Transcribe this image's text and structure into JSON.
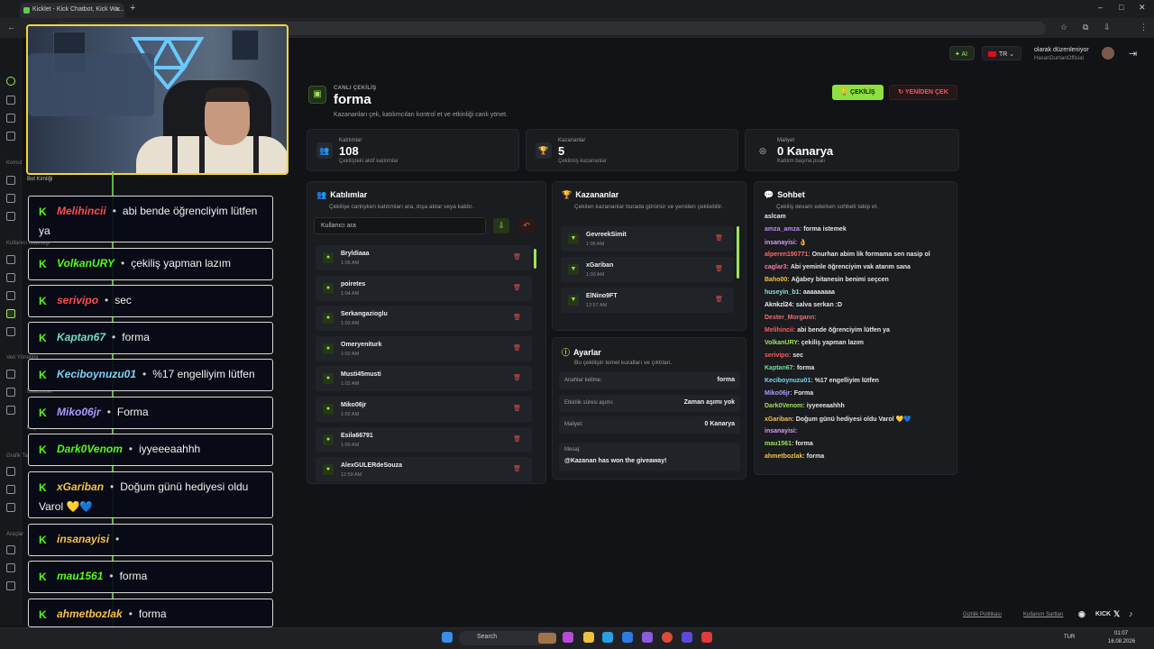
{
  "browser": {
    "tab_title": "Kicklet - Kick Chatbot, Kick Wa...",
    "new_tab": "+",
    "controls": [
      "–",
      "□",
      "✕"
    ]
  },
  "header": {
    "ai_label": "AI",
    "lang_label": "TR",
    "user_status": "olarak düzenleniyor",
    "user_name": "HasanDumanOfficial"
  },
  "rail": {
    "labels": [
      "Komut",
      "Bot Kimliği",
      "Kullanıcı İstatistiği",
      "Veri Yönetimi",
      "İstatistikler",
      "Kuyruklar",
      "Grafik Tasarımı",
      "Araçlar"
    ]
  },
  "page": {
    "kicker": "CANLI ÇEKİLİŞ",
    "title": "forma",
    "subtitle": "Kazananları çek, katılımcıları kontrol et ve etkinliği canlı yönet.",
    "draw_button": "ÇEKİLİŞ",
    "redraw_button": "YENİDEN ÇEK"
  },
  "stats": [
    {
      "label": "Katılımlar",
      "value": "108",
      "sub": "Çekilişteki aktif katılımlar"
    },
    {
      "label": "Kazananlar",
      "value": "5",
      "sub": "Çekilmiş kazananlar"
    },
    {
      "label": "Maliyet",
      "value": "0 Kanarya",
      "sub": "Katılım başına puan"
    }
  ],
  "participants": {
    "title": "Katılımlar",
    "subtitle": "Çekilişe canlıyken katılımları ara, dışa aktar veya kaldır.",
    "search_placeholder": "Kullanıcı ara",
    "rows": [
      {
        "name": "Bryldiaaa",
        "time": "1:05 AM"
      },
      {
        "name": "poiretes",
        "time": "1:04 AM"
      },
      {
        "name": "Serkangazioglu",
        "time": "1:03 AM"
      },
      {
        "name": "Omeryeniturk",
        "time": "1:02 AM"
      },
      {
        "name": "Musti45musti",
        "time": "1:02 AM"
      },
      {
        "name": "Miko06jr",
        "time": "1:02 AM"
      },
      {
        "name": "Esila66791",
        "time": "1:00 AM"
      },
      {
        "name": "AlexGULERdeSouza",
        "time": "12:59 AM"
      }
    ]
  },
  "winners": {
    "title": "Kazananlar",
    "subtitle": "Çekilen kazananlar burada görünür ve yeniden çekilebilir.",
    "rows": [
      {
        "name": "GevreekSimit",
        "time": "1:06 AM"
      },
      {
        "name": "xGariban",
        "time": "1:00 AM"
      },
      {
        "name": "ElNino9FT",
        "time": "12:57 AM"
      }
    ]
  },
  "settings": {
    "title": "Ayarlar",
    "subtitle": "Bu çekilişin temel kuralları ve çıktıları.",
    "rows": [
      {
        "key": "Anahtar kelime:",
        "value": "forma"
      },
      {
        "key": "Etkinlik süresi aşımı:",
        "value": "Zaman aşımı yok"
      },
      {
        "key": "Maliyet:",
        "value": "0 Kanarya"
      }
    ],
    "message_key": "Mesaj:",
    "message_value": "@Kazanan has won the giveaway!"
  },
  "chat": {
    "title": "Sohbet",
    "subtitle": "Çekiliş devam ederken sohbeti takip et.",
    "lines": [
      {
        "user": "aslcam",
        "text": "",
        "color": "#e8e8e8"
      },
      {
        "user": "amza_amza:",
        "text": "forma istemek",
        "color": "#c08cf0"
      },
      {
        "user": "insanayisi:",
        "text": "👌",
        "color": "#d69cf5"
      },
      {
        "user": "alperen190771:",
        "text": "Onurhan abim lik formama sen nasip ol",
        "color": "#ff6b6b"
      },
      {
        "user": "caglar3:",
        "text": "Abi yeminle öğrenciyim vak atarım sana",
        "color": "#ff7aa8"
      },
      {
        "user": "Baho00:",
        "text": "Ağabey bitanesin benimi seçcen",
        "color": "#f7c04a"
      },
      {
        "user": "huseyin_b1:",
        "text": "aaaaaaaaa",
        "color": "#8fe0d8"
      },
      {
        "user": "Aknkzl24:",
        "text": "salva serkan :D",
        "color": "#f4f4f4"
      },
      {
        "user": "Dexter_Morgann:",
        "text": "",
        "color": "#e87070"
      },
      {
        "user": "Melihincii:",
        "text": "abi bende öğrenciyim lütfen ya",
        "color": "#ff5b5b"
      },
      {
        "user": "VolkanURY:",
        "text": "çekiliş yapman lazım",
        "color": "#9ee35a"
      },
      {
        "user": "serivipo:",
        "text": "sec",
        "color": "#ff5b5b"
      },
      {
        "user": "Kaptan67:",
        "text": "forma",
        "color": "#6fe0a0"
      },
      {
        "user": "Keciboynuzu01:",
        "text": "%17 engelliyim lütfen",
        "color": "#7dd3f5"
      },
      {
        "user": "Miko06jr:",
        "text": "Forma",
        "color": "#a89cff"
      },
      {
        "user": "Dark0Venom:",
        "text": "iyyeeeaahhh",
        "color": "#9ee35a"
      },
      {
        "user": "xGariban:",
        "text": "Doğum günü hediyesi oldu Varol 💛💙",
        "color": "#f7c04a"
      },
      {
        "user": "insanayisi:",
        "text": "",
        "color": "#d69cf5"
      },
      {
        "user": "mau1561:",
        "text": "forma",
        "color": "#9ee35a"
      },
      {
        "user": "ahmetbozlak:",
        "text": "forma",
        "color": "#f7c04a"
      }
    ]
  },
  "overlay": {
    "k": "K",
    "dot": "•",
    "messages": [
      {
        "user": "Melihincii",
        "text": "abi bende öğrencliyim lütfen",
        "text2": "ya",
        "color": "#ff4d4d"
      },
      {
        "user": "VolkanURY",
        "text": "çekiliş yapman lazım",
        "color": "#53fc18"
      },
      {
        "user": "serivipo",
        "text": "sec",
        "color": "#ff4d4d"
      },
      {
        "user": "Kaptan67",
        "text": "forma",
        "color": "#6fe0c0"
      },
      {
        "user": "Keciboynuzu01",
        "text": "%17 engelliyim lütfen",
        "color": "#7dd3f5"
      },
      {
        "user": "Miko06jr",
        "text": "Forma",
        "color": "#a89cff"
      },
      {
        "user": "Dark0Venom",
        "text": "iyyeeeaahhh",
        "color": "#53fc18"
      },
      {
        "user": "xGariban",
        "text": "Doğum günü hediyesi oldu",
        "text2": "Varol 💛💙",
        "color": "#f7c04a"
      },
      {
        "user": "insanayisi",
        "text": "",
        "color": "#f7c04a"
      },
      {
        "user": "mau1561",
        "text": "forma",
        "color": "#53fc18"
      },
      {
        "user": "ahmetbozlak",
        "text": "forma",
        "color": "#f7c04a"
      }
    ]
  },
  "footer": {
    "privacy": "Gizlilik Politikası",
    "terms": "Kullanım Şartları",
    "kick": "KICK"
  },
  "taskbar": {
    "search": "Search",
    "lang": "TUR",
    "time": "01:07",
    "date": "16.08.2026"
  }
}
